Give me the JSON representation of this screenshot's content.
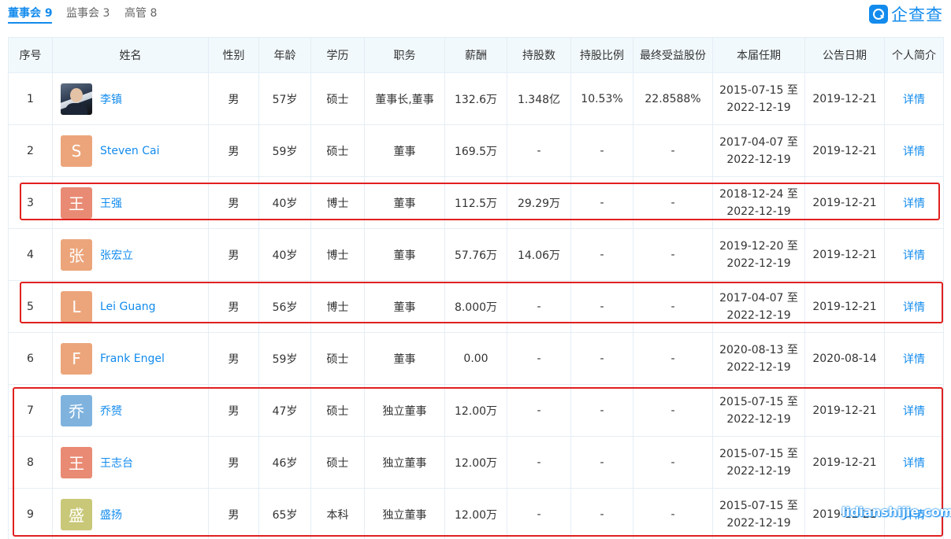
{
  "tabs": [
    {
      "label": "董事会 9",
      "active": true
    },
    {
      "label": "监事会 3",
      "active": false
    },
    {
      "label": "高管 8",
      "active": false
    }
  ],
  "logo": {
    "text": "企查查",
    "icon": "qcc-logo-icon"
  },
  "colors": {
    "accent": "#128bed",
    "highlight": "#e0201f",
    "header_bg": "#f2f9fc"
  },
  "table": {
    "headers": [
      "序号",
      "姓名",
      "性别",
      "年龄",
      "学历",
      "职务",
      "薪酬",
      "持股数",
      "持股比例",
      "最终受益股份",
      "本届任期",
      "公告日期",
      "个人简介"
    ],
    "rows": [
      {
        "no": "1",
        "avatar": "",
        "avatar_color": "photo",
        "name": "李镇",
        "gender": "男",
        "age": "57岁",
        "edu": "硕士",
        "role": "董事长,董事",
        "salary": "132.6万",
        "shares": "1.348亿",
        "ratio": "10.53%",
        "benefit": "22.8588%",
        "term_start": "2015-07-15 至",
        "term_end": "2022-12-19",
        "date": "2019-12-21",
        "detail": "详情"
      },
      {
        "no": "2",
        "avatar": "S",
        "avatar_color": "#eca57b",
        "name": "Steven Cai",
        "gender": "男",
        "age": "59岁",
        "edu": "硕士",
        "role": "董事",
        "salary": "169.5万",
        "shares": "-",
        "ratio": "-",
        "benefit": "-",
        "term_start": "2017-04-07 至",
        "term_end": "2022-12-19",
        "date": "2019-12-21",
        "detail": "详情"
      },
      {
        "no": "3",
        "avatar": "王",
        "avatar_color": "#e98b74",
        "name": "王强",
        "gender": "男",
        "age": "40岁",
        "edu": "博士",
        "role": "董事",
        "salary": "112.5万",
        "shares": "29.29万",
        "ratio": "-",
        "benefit": "-",
        "term_start": "2018-12-24 至",
        "term_end": "2022-12-19",
        "date": "2019-12-21",
        "detail": "详情"
      },
      {
        "no": "4",
        "avatar": "张",
        "avatar_color": "#eca57b",
        "name": "张宏立",
        "gender": "男",
        "age": "40岁",
        "edu": "博士",
        "role": "董事",
        "salary": "57.76万",
        "shares": "14.06万",
        "ratio": "-",
        "benefit": "-",
        "term_start": "2019-12-20 至",
        "term_end": "2022-12-19",
        "date": "2019-12-21",
        "detail": "详情"
      },
      {
        "no": "5",
        "avatar": "L",
        "avatar_color": "#eca57b",
        "name": "Lei Guang",
        "gender": "男",
        "age": "56岁",
        "edu": "博士",
        "role": "董事",
        "salary": "8.000万",
        "shares": "-",
        "ratio": "-",
        "benefit": "-",
        "term_start": "2017-04-07 至",
        "term_end": "2022-12-19",
        "date": "2019-12-21",
        "detail": "详情"
      },
      {
        "no": "6",
        "avatar": "F",
        "avatar_color": "#eca57b",
        "name": "Frank Engel",
        "gender": "男",
        "age": "59岁",
        "edu": "硕士",
        "role": "董事",
        "salary": "0.00",
        "shares": "-",
        "ratio": "-",
        "benefit": "-",
        "term_start": "2020-08-13 至",
        "term_end": "2022-12-19",
        "date": "2020-08-14",
        "detail": "详情"
      },
      {
        "no": "7",
        "avatar": "乔",
        "avatar_color": "#7fb3de",
        "name": "乔赟",
        "gender": "男",
        "age": "47岁",
        "edu": "硕士",
        "role": "独立董事",
        "salary": "12.00万",
        "shares": "-",
        "ratio": "-",
        "benefit": "-",
        "term_start": "2015-07-15 至",
        "term_end": "2022-12-19",
        "date": "2019-12-21",
        "detail": "详情"
      },
      {
        "no": "8",
        "avatar": "王",
        "avatar_color": "#e98b74",
        "name": "王志台",
        "gender": "男",
        "age": "46岁",
        "edu": "硕士",
        "role": "独立董事",
        "salary": "12.00万",
        "shares": "-",
        "ratio": "-",
        "benefit": "-",
        "term_start": "2015-07-15 至",
        "term_end": "2022-12-19",
        "date": "2019-12-21",
        "detail": "详情"
      },
      {
        "no": "9",
        "avatar": "盛",
        "avatar_color": "#c9c878",
        "name": "盛扬",
        "gender": "男",
        "age": "65岁",
        "edu": "本科",
        "role": "独立董事",
        "salary": "12.00万",
        "shares": "-",
        "ratio": "-",
        "benefit": "-",
        "term_start": "2015-07-15 至",
        "term_end": "2022-12-19",
        "date": "2019-12-21",
        "detail": "详情"
      }
    ]
  },
  "watermark": "lidianshijie.com"
}
